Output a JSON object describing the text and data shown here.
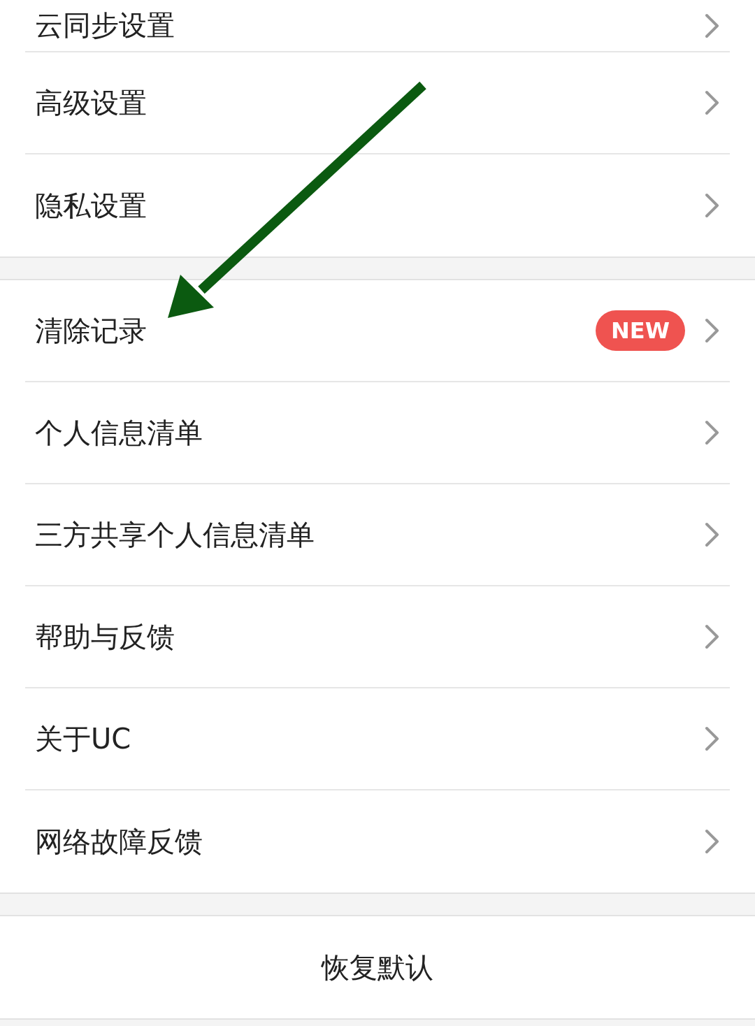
{
  "sections": [
    {
      "items": [
        {
          "label": "云同步设置"
        },
        {
          "label": "高级设置"
        },
        {
          "label": "隐私设置"
        }
      ]
    },
    {
      "items": [
        {
          "label": "清除记录",
          "badge": "NEW"
        },
        {
          "label": "个人信息清单"
        },
        {
          "label": "三方共享个人信息清单"
        },
        {
          "label": "帮助与反馈"
        },
        {
          "label": "关于UC"
        },
        {
          "label": "网络故障反馈"
        }
      ]
    }
  ],
  "reset_button": "恢复默认"
}
